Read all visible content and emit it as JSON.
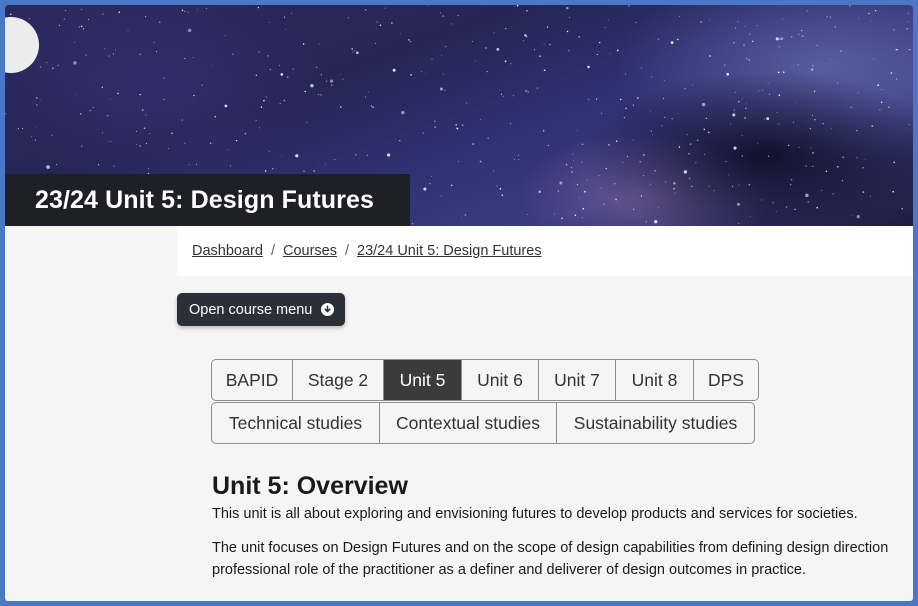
{
  "course": {
    "title": "23/24 Unit 5: Design Futures"
  },
  "breadcrumb": {
    "items": [
      "Dashboard",
      "Courses",
      "23/24 Unit 5: Design Futures"
    ],
    "separator": "/"
  },
  "course_menu_button": {
    "label": "Open course menu",
    "icon": "chevron-down-circle-icon"
  },
  "drawer_toggle": {
    "icon": "list-icon"
  },
  "tabs": {
    "row1": [
      "BAPID",
      "Stage 2",
      "Unit 5",
      "Unit 6",
      "Unit 7",
      "Unit 8",
      "DPS"
    ],
    "row2": [
      "Technical studies",
      "Contextual studies",
      "Sustainability studies"
    ],
    "active": "Unit 5"
  },
  "content": {
    "heading": "Unit 5: Overview",
    "paragraph1": "This unit is all about exploring and envisioning futures to develop products and services for societies.",
    "paragraph2_line1": "The unit focuses on Design Futures and on the scope of design capabilities from defining design direction",
    "paragraph2_line2": "professional role of the practitioner as a definer and deliverer of design outcomes in practice."
  },
  "colors": {
    "page_border": "#4a77c8",
    "title_band": "#1f1f26",
    "active_tab": "#3b3b3b",
    "menu_button": "#2b3038"
  }
}
